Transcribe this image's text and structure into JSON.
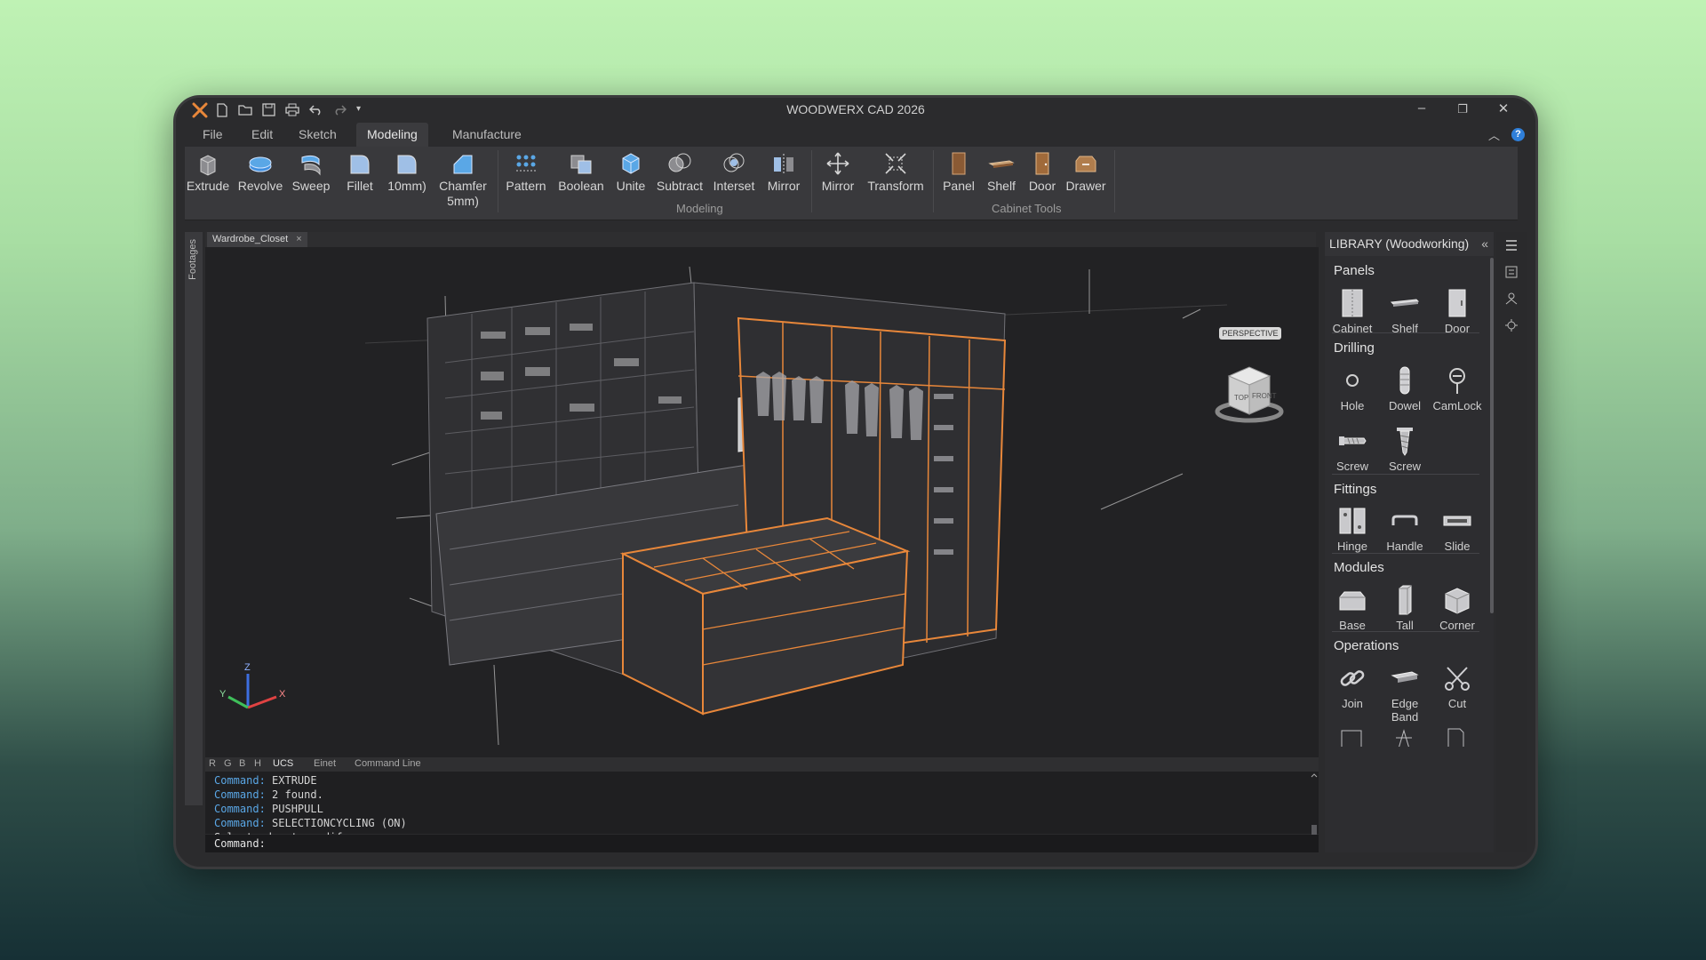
{
  "app": {
    "title": "WOODWERX CAD 2026"
  },
  "menu": [
    "File",
    "Edit",
    "Sketch",
    "Modeling",
    "Manufacture"
  ],
  "ribbon": {
    "tools_main": [
      {
        "label": "Extrude",
        "icon": "extrude-icon"
      },
      {
        "label": "Revolve",
        "icon": "revolve-icon"
      },
      {
        "label": "Sweep",
        "icon": "sweep-icon"
      },
      {
        "label": "Fillet",
        "icon": "fillet-icon"
      },
      {
        "label": "10mm)",
        "icon": "fillet-10mm-icon"
      },
      {
        "label": "Chamfer 5mm)",
        "label_line1": "Chamfer",
        "label_line2": "5mm)",
        "icon": "chamfer-icon"
      }
    ],
    "tools_modeling": [
      {
        "label": "Pattern",
        "icon": "pattern-icon"
      },
      {
        "label": "Boolean",
        "icon": "boolean-icon"
      },
      {
        "label": "Unite",
        "icon": "unite-icon"
      },
      {
        "label": "Subtract",
        "icon": "subtract-icon"
      },
      {
        "label": "Interset",
        "icon": "intersect-icon"
      },
      {
        "label": "Mirror",
        "icon": "mirror-icon"
      }
    ],
    "tools_transform": [
      {
        "label": "Mirror",
        "icon": "move-icon"
      },
      {
        "label": "Transform",
        "icon": "transform-icon"
      }
    ],
    "tools_cabinet": [
      {
        "label": "Panel",
        "icon": "panel-icon"
      },
      {
        "label": "Shelf",
        "icon": "shelf-icon"
      },
      {
        "label": "Door",
        "icon": "door-icon"
      },
      {
        "label": "Drawer",
        "icon": "drawer-icon"
      }
    ],
    "group_modeling": "Modeling",
    "group_cabinet": "Cabinet Tools"
  },
  "left_strip_label": "Footages",
  "doc_tab": {
    "name": "Wardrobe_Closet",
    "close": "×"
  },
  "viewcube": {
    "top": "TOP",
    "front": "FRONT",
    "mode": "PERSPECTIVE"
  },
  "axes": {
    "z": "Z",
    "y": "Y",
    "x": "X"
  },
  "command_tabs": [
    "R",
    "G",
    "B",
    "H",
    "UCS",
    "Einet",
    "Command Line"
  ],
  "command_history": [
    {
      "key": "Command:",
      "value": "EXTRUDE"
    },
    {
      "key": "Command:",
      "value": "2 found."
    },
    {
      "key": "Command:",
      "value": "PUSHPULL"
    },
    {
      "key": "Command:",
      "value": "SELECTIONCYCLING (ON)"
    },
    {
      "key": "",
      "value": "Select edge to modify:"
    }
  ],
  "command_prompt": "Command:",
  "library": {
    "title": "LIBRARY (Woodworking)",
    "collapse": "«",
    "sections": [
      {
        "title": "Panels",
        "items": [
          {
            "label": "Cabinet",
            "icon": "cabinet-icon"
          },
          {
            "label": "Shelf",
            "icon": "shelf-icon"
          },
          {
            "label": "Door",
            "icon": "door-icon"
          }
        ]
      },
      {
        "title": "Drilling",
        "items": [
          {
            "label": "Hole",
            "icon": "hole-icon"
          },
          {
            "label": "Dowel",
            "icon": "dowel-icon"
          },
          {
            "label": "CamLock",
            "icon": "camlock-icon"
          },
          {
            "label": "Screw",
            "icon": "screw-icon"
          },
          {
            "label": "Screw",
            "icon": "screw-vertical-icon"
          }
        ]
      },
      {
        "title": "Fittings",
        "items": [
          {
            "label": "Hinge",
            "icon": "hinge-icon"
          },
          {
            "label": "Handle",
            "icon": "handle-icon"
          },
          {
            "label": "Slide",
            "icon": "slide-icon"
          }
        ]
      },
      {
        "title": "Modules",
        "items": [
          {
            "label": "Base",
            "icon": "base-module-icon"
          },
          {
            "label": "Tall",
            "icon": "tall-module-icon"
          },
          {
            "label": "Corner",
            "icon": "corner-module-icon"
          }
        ]
      },
      {
        "title": "Operations",
        "items": [
          {
            "label": "Join",
            "icon": "join-icon"
          },
          {
            "label": "Edge Band",
            "icon": "edge-band-icon"
          },
          {
            "label": "Cut",
            "icon": "cut-icon"
          }
        ]
      }
    ]
  },
  "colors": {
    "accent_orange": "#e8873a",
    "accent_blue": "#2f7fd9",
    "command_key": "#5aa7e6"
  }
}
